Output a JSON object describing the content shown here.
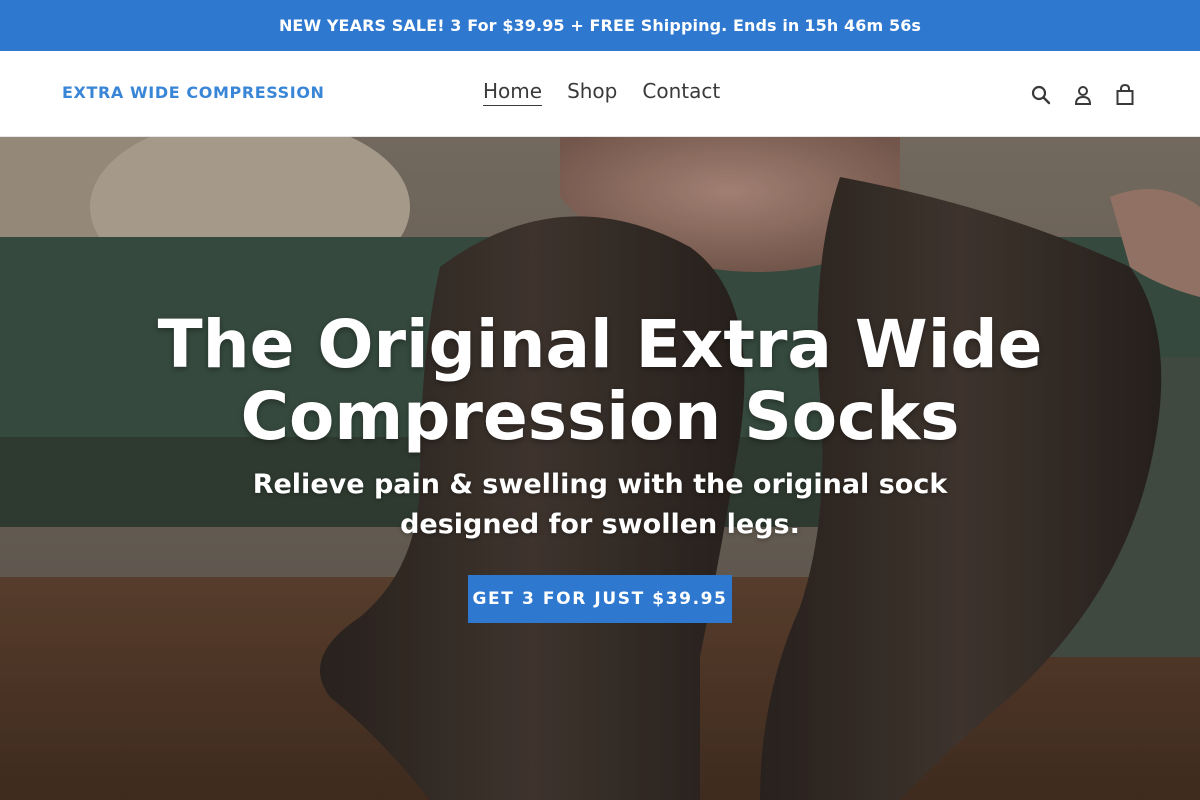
{
  "announcement": {
    "text": "NEW YEARS SALE! 3 For $39.95 + FREE Shipping. Ends in",
    "countdown": "15h 46m 56s"
  },
  "header": {
    "logo": "EXTRA WIDE COMPRESSION",
    "nav": [
      {
        "label": "Home",
        "active": true
      },
      {
        "label": "Shop",
        "active": false
      },
      {
        "label": "Contact",
        "active": false
      }
    ],
    "icons": [
      "search-icon",
      "account-icon",
      "cart-icon"
    ]
  },
  "hero": {
    "title_line1": "The Original Extra Wide",
    "title_line2": "Compression Socks",
    "subtitle": "Relieve pain & swelling with the original sock designed for swollen legs.",
    "cta_label": "GET 3 FOR JUST $39.95"
  },
  "colors": {
    "brand_blue": "#2f78d0",
    "logo_blue": "#3a86d6",
    "nav_text": "#3a3a3a"
  }
}
